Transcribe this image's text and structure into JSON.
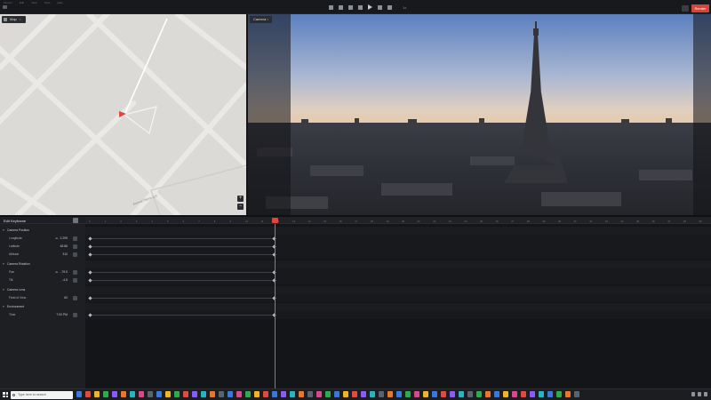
{
  "menubar": {
    "items": [
      "Flyover",
      "Edit",
      "View",
      "Tools",
      "Help"
    ]
  },
  "toolbar": {
    "transport": [
      "skip-back",
      "step-back",
      "play",
      "step-forward",
      "skip-forward"
    ],
    "speed": "1x",
    "render_label": "Render",
    "accent": "#d6453a"
  },
  "map_panel": {
    "tab_label": "Map",
    "zoom_in": "+",
    "zoom_out": "−",
    "street_label": "Avenue Pierre Loti"
  },
  "camera_panel": {
    "tab_label": "Camera"
  },
  "properties": {
    "title": "Edit Keyframe",
    "rows": [
      {
        "type": "group",
        "label": "Camera Position"
      },
      {
        "type": "prop",
        "label": "Longitude",
        "value": "2.295"
      },
      {
        "type": "prop",
        "label": "Latitude",
        "value": "48.86"
      },
      {
        "type": "prop",
        "label": "Altitude",
        "value": "310"
      },
      {
        "type": "group",
        "label": "Camera Rotation"
      },
      {
        "type": "prop",
        "label": "Pan",
        "value": "-79.5"
      },
      {
        "type": "prop",
        "label": "Tilt",
        "value": "-4.8"
      },
      {
        "type": "group",
        "label": "Camera Lens"
      },
      {
        "type": "prop",
        "label": "Field of View",
        "value": "60"
      },
      {
        "type": "group",
        "label": "Environment"
      },
      {
        "type": "prop",
        "label": "Time",
        "value": "7:00 PM"
      }
    ]
  },
  "timeline": {
    "ticks": [
      "0",
      "1",
      "2",
      "3",
      "4",
      "5",
      "6",
      "7",
      "8",
      "9",
      "10",
      "11",
      "12",
      "13",
      "14",
      "15",
      "16",
      "17",
      "18",
      "19",
      "20",
      "21",
      "22",
      "23",
      "24",
      "25",
      "26",
      "27",
      "28",
      "29",
      "30",
      "31",
      "32",
      "33",
      "34",
      "35",
      "36",
      "37",
      "38",
      "39"
    ],
    "playhead_label": "10"
  },
  "taskbar": {
    "search_placeholder": "Type here to search"
  }
}
